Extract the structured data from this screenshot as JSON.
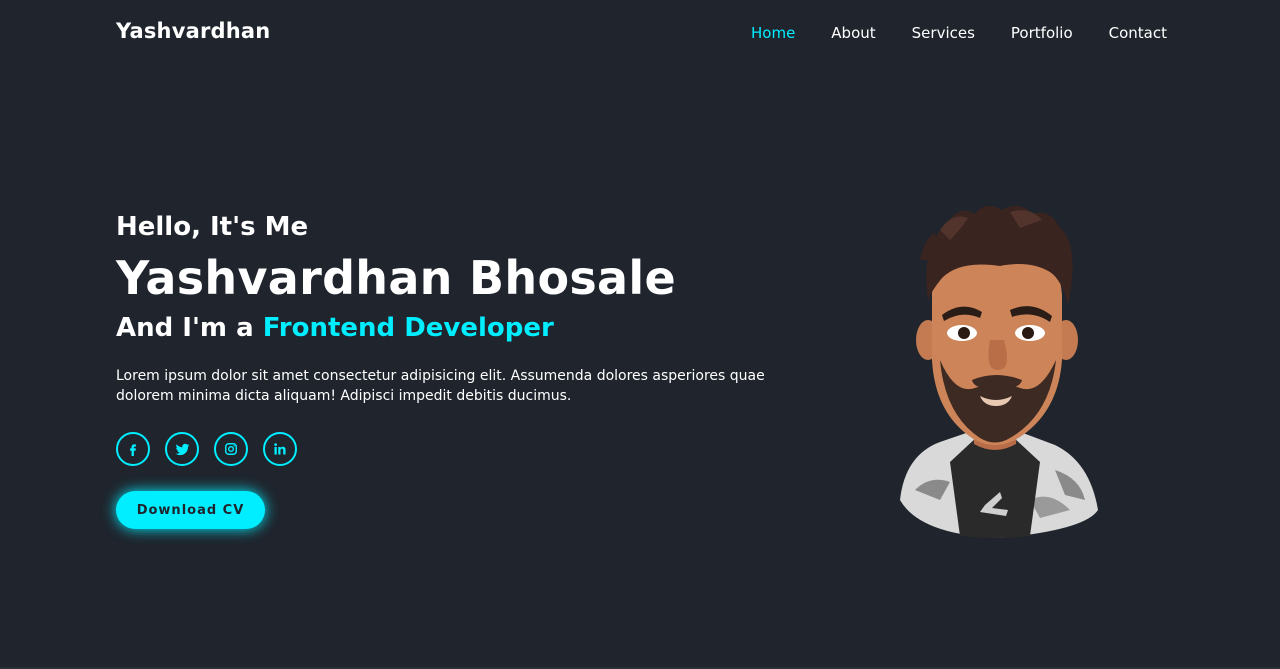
{
  "header": {
    "logo": "Yashvardhan",
    "nav": [
      {
        "label": "Home",
        "active": true
      },
      {
        "label": "About",
        "active": false
      },
      {
        "label": "Services",
        "active": false
      },
      {
        "label": "Portfolio",
        "active": false
      },
      {
        "label": "Contact",
        "active": false
      }
    ]
  },
  "hero": {
    "greeting": "Hello, It's Me",
    "name": "Yashvardhan Bhosale",
    "role_prefix": "And I'm a",
    "role_highlight": "Frontend Developer",
    "description": "Lorem ipsum dolor sit amet consectetur adipisicing elit. Assumenda dolores asperiores quae dolorem minima dicta aliquam! Adipisci impedit debitis ducimus.",
    "socials": [
      {
        "icon": "facebook-icon"
      },
      {
        "icon": "twitter-icon"
      },
      {
        "icon": "instagram-icon"
      },
      {
        "icon": "linkedin-icon"
      }
    ],
    "cv_button": "Download CV"
  },
  "colors": {
    "background": "#1f242d",
    "accent": "#00eeff",
    "text": "#ffffff"
  }
}
